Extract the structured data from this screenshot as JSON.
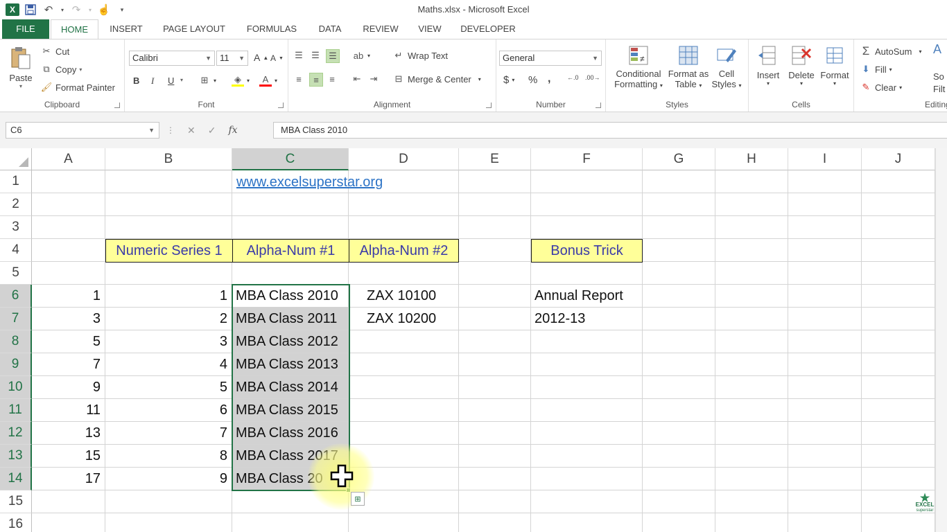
{
  "window": {
    "title": "Maths.xlsx - Microsoft Excel",
    "app_logo": "X"
  },
  "qat": {
    "icons": [
      "excel-logo",
      "save-icon",
      "undo-icon",
      "redo-icon",
      "touch-mode-icon",
      "customize-qat-icon"
    ]
  },
  "tabs": [
    "FILE",
    "HOME",
    "INSERT",
    "PAGE LAYOUT",
    "FORMULAS",
    "DATA",
    "REVIEW",
    "VIEW",
    "DEVELOPER"
  ],
  "ribbon": {
    "clipboard": {
      "label": "Clipboard",
      "paste": "Paste",
      "cut": "Cut",
      "copy": "Copy",
      "format_painter": "Format Painter"
    },
    "font": {
      "label": "Font",
      "font_name": "Calibri",
      "font_size": "11",
      "bold": "B",
      "italic": "I",
      "underline": "U",
      "grow": "A",
      "shrink": "A",
      "font_color_glyph": "A"
    },
    "alignment": {
      "label": "Alignment",
      "wrap_text": "Wrap Text",
      "merge_center": "Merge & Center"
    },
    "number": {
      "label": "Number",
      "format": "General",
      "currency": "$",
      "percent": "%",
      "comma": ","
    },
    "styles": {
      "label": "Styles",
      "conditional_1": "Conditional",
      "conditional_2": "Formatting",
      "format_table_1": "Format as",
      "format_table_2": "Table",
      "cell_styles_1": "Cell",
      "cell_styles_2": "Styles"
    },
    "cells": {
      "label": "Cells",
      "insert": "Insert",
      "delete": "Delete",
      "format": "Format"
    },
    "editing": {
      "label": "Editing",
      "autosum": "AutoSum",
      "fill": "Fill",
      "clear": "Clear",
      "sort_partial_1": "So",
      "sort_partial_2": "Filt"
    }
  },
  "formula_bar": {
    "name_box": "C6",
    "fx": "fx",
    "value": "MBA Class 2010"
  },
  "grid": {
    "columns": [
      "A",
      "B",
      "C",
      "D",
      "E",
      "F",
      "G",
      "H",
      "I",
      "J"
    ],
    "selected_column": "C",
    "rows": [
      "1",
      "2",
      "3",
      "4",
      "5",
      "6",
      "7",
      "8",
      "9",
      "10",
      "11",
      "12",
      "13",
      "14",
      "15",
      "16"
    ],
    "selected_rows": [
      "6",
      "7",
      "8",
      "9",
      "10",
      "11",
      "12",
      "13",
      "14"
    ],
    "link": "www.excelsuperstar.org",
    "headers": {
      "b4": "Numeric Series 1",
      "c4": "Alpha-Num #1",
      "d4": "Alpha-Num #2",
      "f4": "Bonus Trick"
    },
    "col_a": [
      "1",
      "3",
      "5",
      "7",
      "9",
      "11",
      "13",
      "15",
      "17"
    ],
    "col_b": [
      "1",
      "2",
      "3",
      "4",
      "5",
      "6",
      "7",
      "8",
      "9"
    ],
    "col_c": [
      "MBA Class 2010",
      "MBA Class 2011",
      "MBA Class 2012",
      "MBA Class 2013",
      "MBA Class 2014",
      "MBA Class 2015",
      "MBA Class 2016",
      "MBA Class 2017",
      "MBA Class 20"
    ],
    "col_d": [
      "ZAX 10100",
      "ZAX 10200"
    ],
    "col_f": [
      "Annual Report",
      "2012-13"
    ]
  },
  "watermark": {
    "line1": "EXCEL",
    "line2": "superstar"
  },
  "colors": {
    "excel_green": "#217346",
    "header_fill": "#ffff99",
    "header_text": "#3a3aa8",
    "link": "#2c73c6"
  }
}
